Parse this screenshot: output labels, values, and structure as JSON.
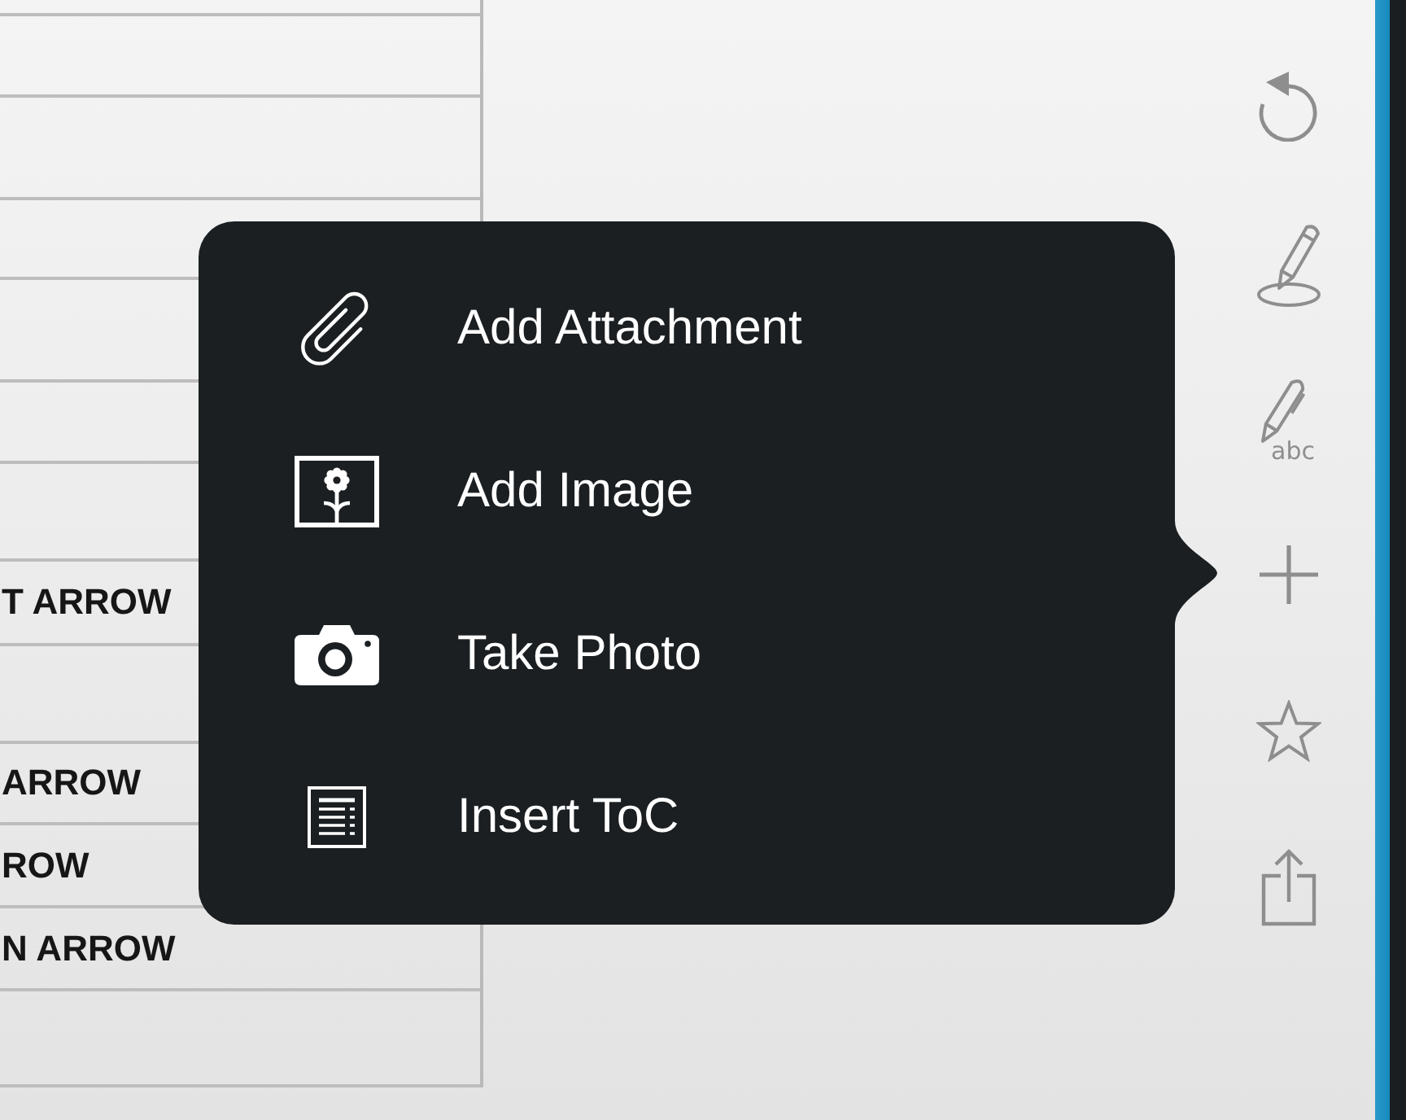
{
  "document": {
    "table": {
      "rows": [
        {
          "kind": "blank"
        },
        {
          "kind": "blank"
        },
        {
          "kind": "blank"
        },
        {
          "kind": "blank"
        },
        {
          "kind": "blank"
        },
        {
          "kind": "blank"
        },
        {
          "kind": "blank"
        },
        {
          "kind": "text",
          "text": "T ARROW"
        },
        {
          "kind": "blank"
        },
        {
          "kind": "text",
          "text": "ARROW"
        },
        {
          "kind": "text",
          "text": "ROW"
        },
        {
          "kind": "text",
          "text": "N ARROW"
        },
        {
          "kind": "blank"
        }
      ]
    }
  },
  "popover": {
    "items": [
      {
        "label": "Add Attachment"
      },
      {
        "label": "Add Image"
      },
      {
        "label": "Take Photo"
      },
      {
        "label": "Insert ToC"
      }
    ]
  },
  "toolbar": {
    "pen_caption": "abc"
  }
}
